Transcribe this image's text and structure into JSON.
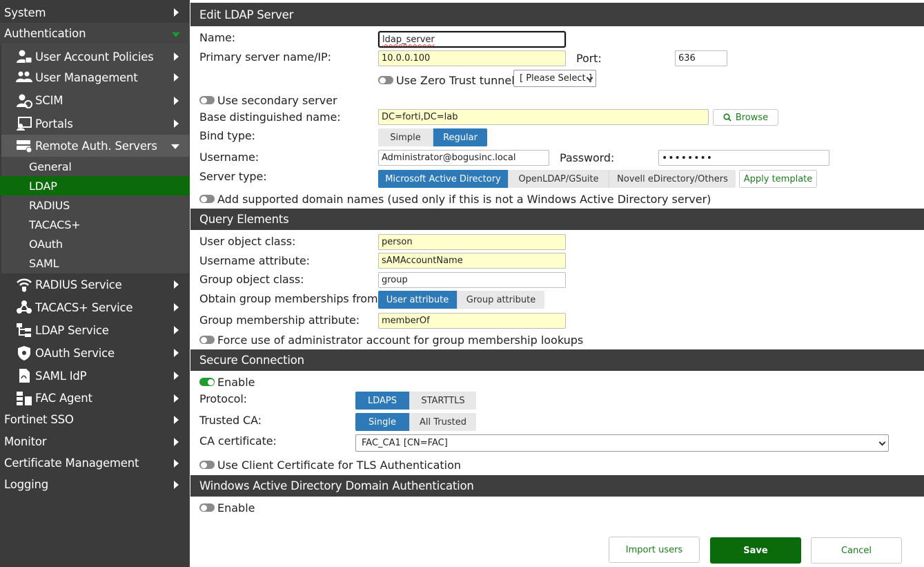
{
  "sidebar": {
    "system": "System",
    "authentication": "Authentication",
    "auth_items": [
      {
        "label": "User Account Policies",
        "icon": "user-lock-icon"
      },
      {
        "label": "User Management",
        "icon": "users-icon"
      },
      {
        "label": "SCIM",
        "icon": "user-sync-icon"
      },
      {
        "label": "Portals",
        "icon": "portal-icon"
      },
      {
        "label": "Remote Auth. Servers",
        "icon": "server-icon"
      }
    ],
    "remote_sub": [
      "General",
      "LDAP",
      "RADIUS",
      "TACACS+",
      "OAuth",
      "SAML"
    ],
    "service_items": [
      {
        "label": "RADIUS Service",
        "icon": "wifi-shield-icon"
      },
      {
        "label": "TACACS+ Service",
        "icon": "network-icon"
      },
      {
        "label": "LDAP Service",
        "icon": "tree-icon"
      },
      {
        "label": "OAuth Service",
        "icon": "shield-icon"
      },
      {
        "label": "SAML IdP",
        "icon": "document-icon"
      },
      {
        "label": "FAC Agent",
        "icon": "agent-icon"
      }
    ],
    "fortinet_sso": "Fortinet SSO",
    "monitor": "Monitor",
    "cert_mgmt": "Certificate Management",
    "logging": "Logging"
  },
  "edit": {
    "header": "Edit LDAP Server",
    "name_label": "Name:",
    "name_value": "ldap_server",
    "primary_label": "Primary server name/IP:",
    "primary_value": "10.0.0.100",
    "port_label": "Port:",
    "port_value": "636",
    "zero_trust_label": "Use Zero Trust tunnel",
    "zero_trust_select": "[ Please Select ]",
    "secondary_label": "Use secondary server",
    "base_dn_label": "Base distinguished name:",
    "base_dn_value": "DC=forti,DC=lab",
    "browse": "Browse",
    "bind_label": "Bind type:",
    "bind_simple": "Simple",
    "bind_regular": "Regular",
    "username_label": "Username:",
    "username_value": "Administrator@bogusinc.local",
    "password_label": "Password:",
    "password_value": "••••••••",
    "server_type_label": "Server type:",
    "server_types": [
      "Microsoft Active Directory",
      "OpenLDAP/GSuite",
      "Novell eDirectory/Others"
    ],
    "apply_template": "Apply template",
    "domain_names_label": "Add supported domain names (used only if this is not a Windows Active Directory server)"
  },
  "query": {
    "header": "Query Elements",
    "user_obj_label": "User object class:",
    "user_obj_value": "person",
    "username_attr_label": "Username attribute:",
    "username_attr_value": "sAMAccountName",
    "group_obj_label": "Group object class:",
    "group_obj_value": "group",
    "obtain_label": "Obtain group memberships from:",
    "obtain_user": "User attribute",
    "obtain_group": "Group attribute",
    "group_attr_label": "Group membership attribute:",
    "group_attr_value": "memberOf",
    "force_admin_label": "Force use of administrator account for group membership lookups"
  },
  "secure": {
    "header": "Secure Connection",
    "enable_label": "Enable",
    "protocol_label": "Protocol:",
    "protocol_ldaps": "LDAPS",
    "protocol_starttls": "STARTTLS",
    "trusted_label": "Trusted CA:",
    "trusted_single": "Single",
    "trusted_all": "All Trusted",
    "ca_label": "CA certificate:",
    "ca_value": "FAC_CA1 [CN=FAC]",
    "client_cert_label": "Use Client Certificate for TLS Authentication"
  },
  "windows": {
    "header": "Windows Active Directory Domain Authentication",
    "enable_label": "Enable"
  },
  "footer": {
    "import": "Import users",
    "save": "Save",
    "cancel": "Cancel"
  },
  "colors": {
    "active_nav": "#0b6b0b",
    "segment_active": "#2e7ab8",
    "toggle_on": "#1f9d2f"
  }
}
